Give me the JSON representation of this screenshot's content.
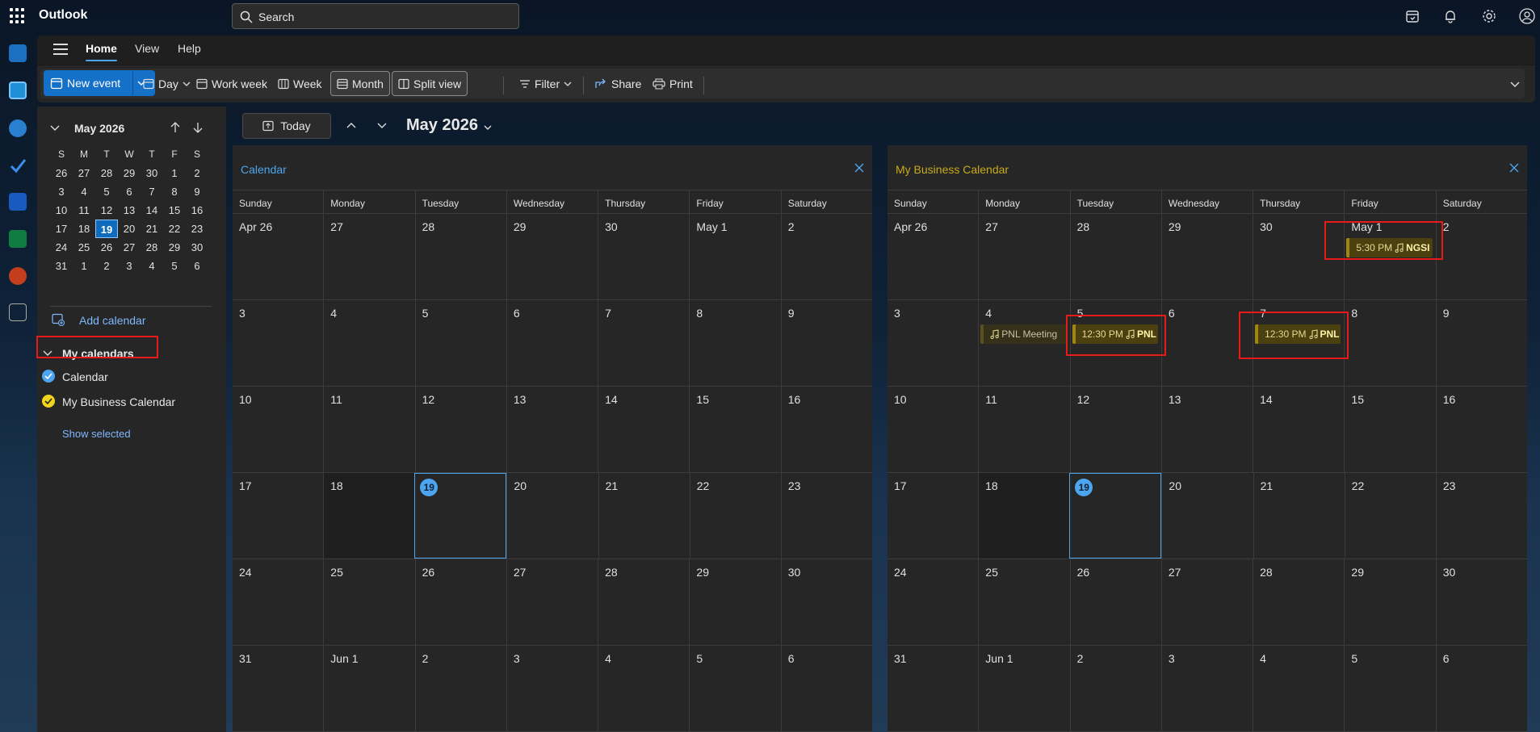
{
  "app": {
    "name": "Outlook"
  },
  "search": {
    "placeholder": "Search"
  },
  "tabs": [
    "Home",
    "View",
    "Help"
  ],
  "ribbon": {
    "new_event": "New event",
    "day": "Day",
    "work_week": "Work week",
    "week": "Week",
    "month": "Month",
    "split_view": "Split view",
    "filter": "Filter",
    "share": "Share",
    "print": "Print"
  },
  "mini_calendar": {
    "title": "May 2026",
    "dow": [
      "S",
      "M",
      "T",
      "W",
      "T",
      "F",
      "S"
    ],
    "weeks": [
      [
        "26",
        "27",
        "28",
        "29",
        "30",
        "1",
        "2"
      ],
      [
        "3",
        "4",
        "5",
        "6",
        "7",
        "8",
        "9"
      ],
      [
        "10",
        "11",
        "12",
        "13",
        "14",
        "15",
        "16"
      ],
      [
        "17",
        "18",
        "19",
        "20",
        "21",
        "22",
        "23"
      ],
      [
        "24",
        "25",
        "26",
        "27",
        "28",
        "29",
        "30"
      ],
      [
        "31",
        "1",
        "2",
        "3",
        "4",
        "5",
        "6"
      ]
    ],
    "today": "19"
  },
  "left_pane": {
    "add_calendar": "Add calendar",
    "my_calendars": "My calendars",
    "calendars": [
      {
        "name": "Calendar",
        "color": "#4ca5ee"
      },
      {
        "name": "My Business Calendar",
        "color": "#f2d41c"
      }
    ],
    "show_selected": "Show selected"
  },
  "toolbar": {
    "today": "Today",
    "month_title": "May 2026"
  },
  "panels": [
    {
      "title": "Calendar",
      "title_color": "#4ca5ee"
    },
    {
      "title": "My Business Calendar",
      "title_color": "#c8aa1a"
    }
  ],
  "weekdays": [
    "Sunday",
    "Monday",
    "Tuesday",
    "Wednesday",
    "Thursday",
    "Friday",
    "Saturday"
  ],
  "month_grid": [
    [
      "Apr 26",
      "27",
      "28",
      "29",
      "30",
      "May 1",
      "2"
    ],
    [
      "3",
      "4",
      "5",
      "6",
      "7",
      "8",
      "9"
    ],
    [
      "10",
      "11",
      "12",
      "13",
      "14",
      "15",
      "16"
    ],
    [
      "17",
      "18",
      "19",
      "20",
      "21",
      "22",
      "23"
    ],
    [
      "24",
      "25",
      "26",
      "27",
      "28",
      "29",
      "30"
    ],
    [
      "31",
      "Jun 1",
      "2",
      "3",
      "4",
      "5",
      "6"
    ]
  ],
  "events": {
    "may1": {
      "time": "5:30 PM",
      "title": "NGSI"
    },
    "may4": {
      "time": "",
      "title": "PNL Meeting"
    },
    "may5": {
      "time": "12:30 PM",
      "title": "PNL"
    },
    "may7": {
      "time": "12:30 PM",
      "title": "PNL"
    }
  },
  "colors": {
    "accent": "#4ca5ee",
    "highlight": "#e81a1a",
    "business": "#f2d41c"
  }
}
